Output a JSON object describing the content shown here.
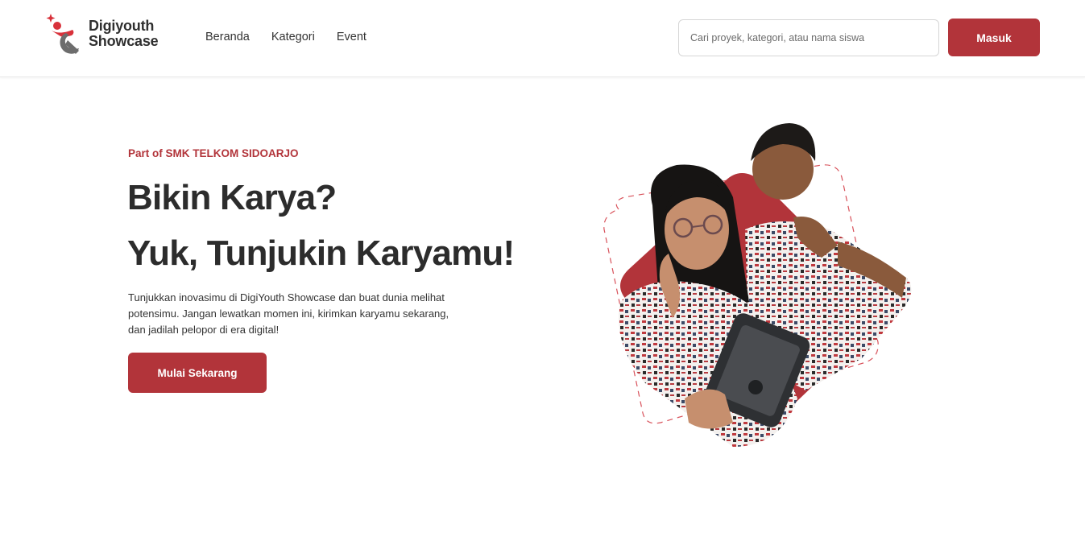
{
  "brand": {
    "line1": "Digiyouth",
    "line2": "Showcase",
    "accent": "#b2343a",
    "logo_gray": "#6d6d6d",
    "logo_red": "#d8313a"
  },
  "nav": {
    "items": [
      {
        "label": "Beranda"
      },
      {
        "label": "Kategori"
      },
      {
        "label": "Event"
      }
    ]
  },
  "search": {
    "placeholder": "Cari proyek, kategori, atau nama siswa",
    "value": ""
  },
  "auth": {
    "login_label": "Masuk"
  },
  "hero": {
    "eyebrow": "Part of SMK TELKOM SIDOARJO",
    "headline_1": "Bikin Karya?",
    "headline_2": "Yuk, Tunjukin Karyamu!",
    "description": "Tunjukkan inovasimu di DigiYouth Showcase dan buat dunia melihat potensimu. Jangan lewatkan momen ini, kirimkan karyamu sekarang, dan jadilah pelopor di era digital!",
    "cta_label": "Mulai Sekarang",
    "image": "two-students-batik-uniform-with-tablet"
  }
}
